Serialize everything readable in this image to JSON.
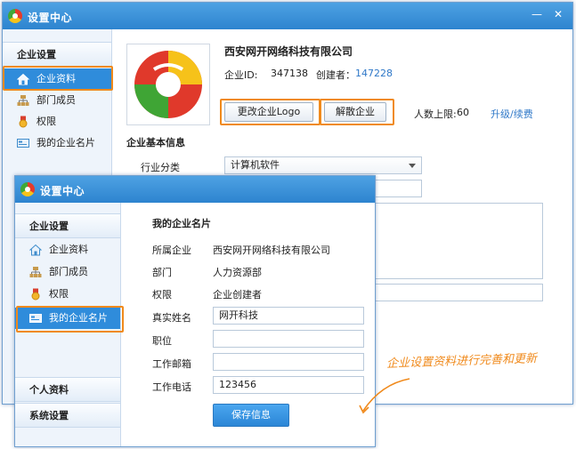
{
  "window_title": "设置中心",
  "back": {
    "sidebar_header": "企业设置",
    "items": [
      "企业资料",
      "部门成员",
      "权限",
      "我的企业名片"
    ],
    "company_name": "西安网开网络科技有限公司",
    "company_id_label": "企业ID:",
    "company_id": "347138",
    "creator_label": "创建者：",
    "creator": "147228",
    "change_logo": "更改企业Logo",
    "dissolve": "解散企业",
    "limit_label": "人数上限:",
    "limit_value": "60",
    "upgrade": "升级/续费",
    "section_title": "企业基本信息",
    "industry_label": "行业分类",
    "industry_value": "计算机软件"
  },
  "front": {
    "sidebar_header": "企业设置",
    "items": [
      "企业资料",
      "部门成员",
      "权限",
      "我的企业名片"
    ],
    "personal": "个人资料",
    "system": "系统设置",
    "card_title": "我的企业名片",
    "rows": [
      {
        "label": "所属企业",
        "value": "西安网开网络科技有限公司"
      },
      {
        "label": "部门",
        "value": "人力资源部"
      },
      {
        "label": "权限",
        "value": "企业创建者"
      }
    ],
    "name_label": "真实姓名",
    "name_value": "网开科技",
    "position_label": "职位",
    "position_value": "",
    "email_label": "工作邮箱",
    "email_value": "",
    "phone_label": "工作电话",
    "phone_value": "123456",
    "save": "保存信息"
  },
  "annotation": "企业设置资料进行完善和更新",
  "colors": {
    "accent": "#2f8cdb",
    "highlight": "#f08a1c",
    "titlebar": "#3a92da"
  }
}
